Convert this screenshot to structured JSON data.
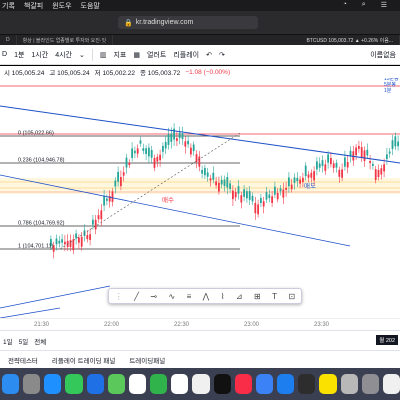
{
  "menubar": {
    "items": [
      "기록",
      "책갈피",
      "윈도우",
      "도움말"
    ]
  },
  "browser": {
    "url": "kr.tradingview.com"
  },
  "tabs": [
    {
      "label": "D"
    },
    {
      "label": "항상 | 블라인드 업종별로 투자와 요진·잇"
    },
    {
      "label": "BTCUSD 105,003.72 ▲ +0.26% 이음..."
    }
  ],
  "toolbar": {
    "symbol": "D",
    "interval_1m": "1분",
    "interval_1h": "1시간",
    "interval_4h": "4시간",
    "indicators": "지표",
    "alert": "얼러트",
    "replay": "리플레이",
    "title_right": "이름없음"
  },
  "ohlc": {
    "open": "시 105,005.24",
    "high": "고 105,005.24",
    "low": "저 105,002.22",
    "close": "종 105,003.72",
    "change": "−1.08 (−0.00%)"
  },
  "chart_data": {
    "type": "candlestick",
    "fib_levels": [
      {
        "label": "0 (105,022.66)",
        "ratio": 0
      },
      {
        "label": "0.236 (104,946.78)",
        "ratio": 0.236
      },
      {
        "label": "0.786 (104,769.92)",
        "ratio": 0.786
      },
      {
        "label": "1 (104,701.11)",
        "ratio": 1
      }
    ],
    "annotations": [
      "매수",
      "매도"
    ],
    "right_labels": [
      "15분봉",
      "5분봉",
      "1분"
    ],
    "colors": {
      "up": "#26a69a",
      "down": "#f23645",
      "fib": "#333333",
      "trend": "#1e50c8",
      "zone": "#f5a623"
    }
  },
  "xaxis": {
    "labels": [
      "21:30",
      "22:00",
      "22:30",
      "23:00",
      "23:30"
    ]
  },
  "bottombar": {
    "range_1d": "1일",
    "range_5d": "5일",
    "all": "전체",
    "date": "월 202"
  },
  "panel": {
    "tabs": [
      "전략테스터",
      "리플레이 트레이딩 패널",
      "트레이딩패널"
    ]
  },
  "dock": {
    "apps": [
      {
        "name": "finder",
        "color": "#2d8cf0"
      },
      {
        "name": "launchpad",
        "color": "#8a8a8a"
      },
      {
        "name": "safari",
        "color": "#1e90ff"
      },
      {
        "name": "messages",
        "color": "#34c759"
      },
      {
        "name": "mail",
        "color": "#1f6fe5"
      },
      {
        "name": "maps",
        "color": "#5ac85a"
      },
      {
        "name": "photos",
        "color": "#ffffff"
      },
      {
        "name": "facetime",
        "color": "#2fb34a"
      },
      {
        "name": "calendar",
        "color": "#ffffff"
      },
      {
        "name": "reminders",
        "color": "#f0f0f0"
      },
      {
        "name": "tv",
        "color": "#111111"
      },
      {
        "name": "music",
        "color": "#fa2d48"
      },
      {
        "name": "keynote",
        "color": "#3b82f6"
      },
      {
        "name": "appstore",
        "color": "#1d7ef0"
      },
      {
        "name": "kakao-t",
        "color": "#2d2d2d"
      },
      {
        "name": "kakaotalk",
        "color": "#fae100"
      },
      {
        "name": "contacts",
        "color": "#b8b8b8"
      },
      {
        "name": "settings",
        "color": "#8e8e93"
      },
      {
        "name": "chrome",
        "color": "#f0f0f0"
      }
    ]
  }
}
